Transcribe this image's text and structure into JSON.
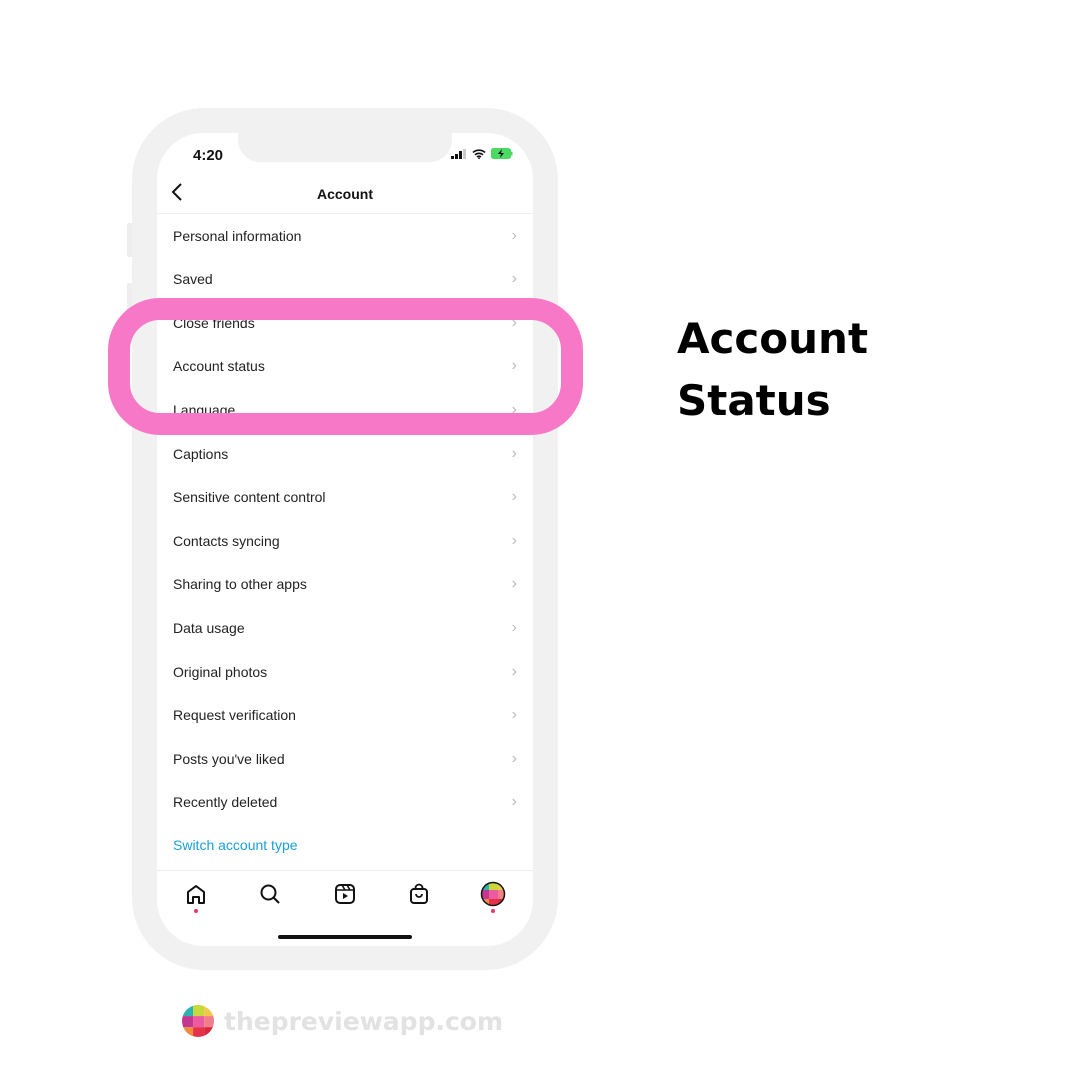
{
  "status_bar": {
    "time": "4:20"
  },
  "header": {
    "title": "Account",
    "back_icon": "chevron-left-icon"
  },
  "menu_items": [
    {
      "label": "Personal information"
    },
    {
      "label": "Saved"
    },
    {
      "label": "Close friends"
    },
    {
      "label": "Account status"
    },
    {
      "label": "Language"
    },
    {
      "label": "Captions"
    },
    {
      "label": "Sensitive content control"
    },
    {
      "label": "Contacts syncing"
    },
    {
      "label": "Sharing to other apps"
    },
    {
      "label": "Data usage"
    },
    {
      "label": "Original photos"
    },
    {
      "label": "Request verification"
    },
    {
      "label": "Posts you've liked"
    },
    {
      "label": "Recently deleted"
    }
  ],
  "switch_account": {
    "label": "Switch account type",
    "color": "#1aa0d6"
  },
  "tabbar": [
    "home-icon",
    "search-icon",
    "reels-icon",
    "shop-icon",
    "profile-avatar"
  ],
  "callout": {
    "line1": "Account",
    "line2": "Status",
    "highlight_color": "#f878c8"
  },
  "brand": {
    "text": "thepreviewapp.com"
  }
}
